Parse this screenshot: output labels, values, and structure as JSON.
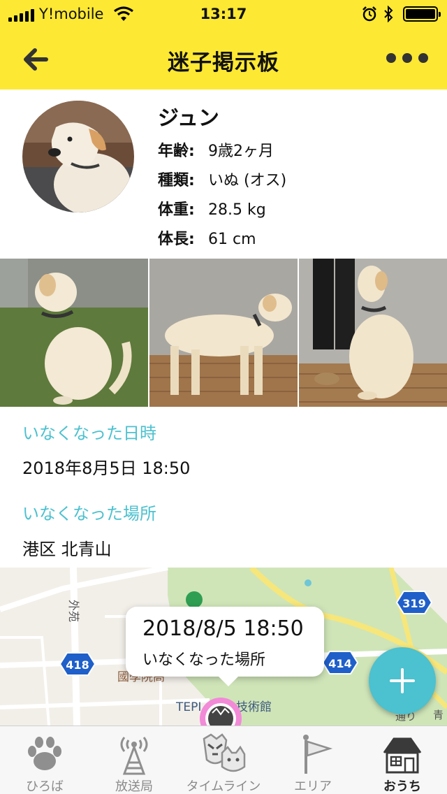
{
  "status_bar": {
    "carrier": "Y!mobile",
    "time": "13:17",
    "icons": [
      "signal-icon",
      "wifi-icon",
      "alarm-icon",
      "bluetooth-icon",
      "battery-icon"
    ],
    "battery_level": 1.0
  },
  "nav": {
    "title": "迷子掲示板",
    "back_icon": "arrow-left-icon",
    "more_icon": "more-dots-icon"
  },
  "pet": {
    "name": "ジュン",
    "info": [
      {
        "label": "年齢:",
        "value": "9歳2ヶ月"
      },
      {
        "label": "種類:",
        "value": "いぬ (オス)"
      },
      {
        "label": "体重:",
        "value": "28.5 kg"
      },
      {
        "label": "体長:",
        "value": "61 cm"
      }
    ]
  },
  "lost": {
    "date_label": "いなくなった日時",
    "date_value": "2018年8月5日 18:50",
    "place_label": "いなくなった場所",
    "place_value": "港区 北青山"
  },
  "map": {
    "labels": {
      "road_gaien": "外苑",
      "place_kokugakuin": "國學院高",
      "place_tepia": "TEPI",
      "place_tech": "技術館",
      "road_edge": "通り",
      "road_edge2": "青"
    },
    "route_numbers": [
      "418",
      "319",
      "414"
    ],
    "callout_time": "2018/8/5 18:50",
    "callout_subtitle": "いなくなった場所",
    "fab_icon": "plus-icon"
  },
  "tabs": [
    {
      "label": "ひろば",
      "icon": "paw-icon",
      "active": false
    },
    {
      "label": "放送局",
      "icon": "antenna-icon",
      "active": false
    },
    {
      "label": "タイムライン",
      "icon": "pets-faces-icon",
      "active": false
    },
    {
      "label": "エリア",
      "icon": "flag-icon",
      "active": false
    },
    {
      "label": "おうち",
      "icon": "house-icon",
      "active": true
    }
  ],
  "colors": {
    "header": "#fde833",
    "accent": "#4cc1cf",
    "callout_ring": "#f28ad8"
  }
}
